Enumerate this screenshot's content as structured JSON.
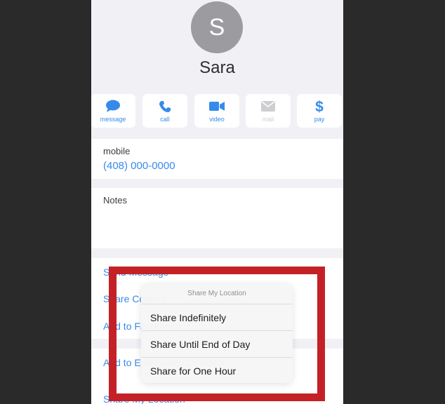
{
  "contact": {
    "initial": "S",
    "name": "Sara"
  },
  "actions": [
    {
      "label": "message",
      "icon": "message-icon",
      "enabled": true
    },
    {
      "label": "call",
      "icon": "phone-icon",
      "enabled": true
    },
    {
      "label": "video",
      "icon": "video-icon",
      "enabled": true
    },
    {
      "label": "mail",
      "icon": "mail-icon",
      "enabled": false
    },
    {
      "label": "pay",
      "icon": "dollar-icon",
      "enabled": true
    }
  ],
  "phone_field": {
    "label": "mobile",
    "value": "(408) 000-0000"
  },
  "notes_field": {
    "label": "Notes"
  },
  "list_rows": [
    {
      "text": "Send Message"
    },
    {
      "text": "Share Contact"
    },
    {
      "text": "Add to Favorites"
    },
    {
      "text": "Add to Emergency Contacts"
    },
    {
      "text": "Share My Location"
    }
  ],
  "share_menu": {
    "title": "Share My Location",
    "items": [
      "Share Indefinitely",
      "Share Until End of Day",
      "Share for One Hour"
    ]
  },
  "colors": {
    "accent": "#1b7be8",
    "highlight": "#c42127",
    "avatar": "#8e8e93",
    "background": "#efeff4"
  }
}
